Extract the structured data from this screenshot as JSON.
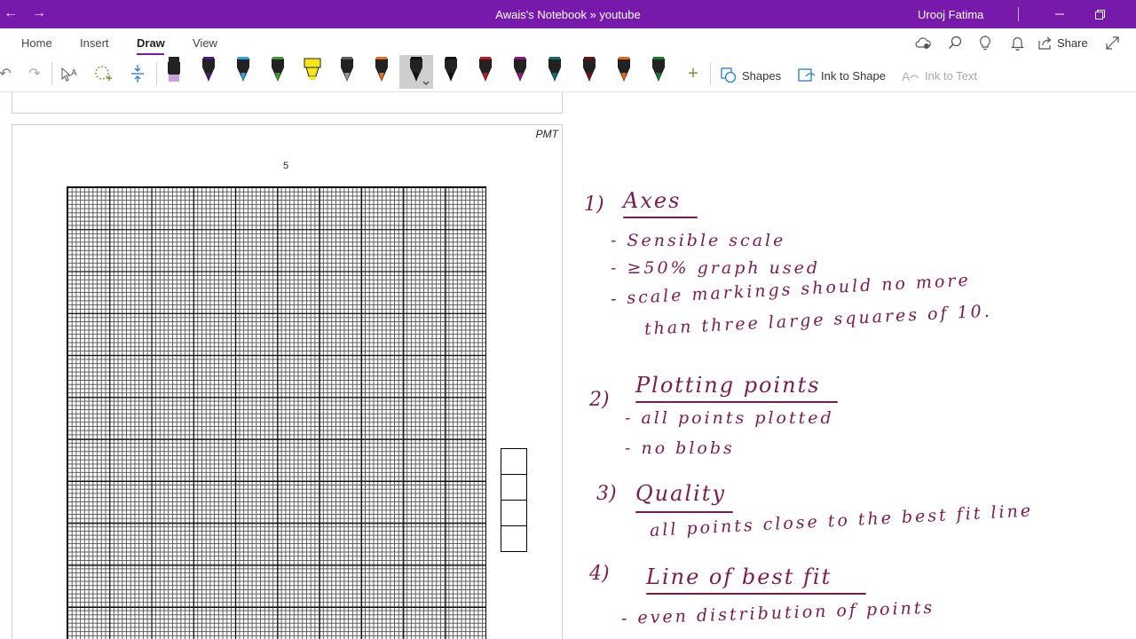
{
  "window": {
    "title": "Awais's Notebook » youtube",
    "user": "Urooj Fatima"
  },
  "tabs": [
    {
      "label": "Home"
    },
    {
      "label": "Insert"
    },
    {
      "label": "Draw",
      "active": true
    },
    {
      "label": "View"
    }
  ],
  "ribbon_right": {
    "share_label": "Share"
  },
  "toolbar": {
    "pens": [
      {
        "color": "#c9a0dc",
        "type": "highlighter"
      },
      {
        "color": "#4b1c7a",
        "type": "pen"
      },
      {
        "color": "#2aa7d8",
        "type": "pen"
      },
      {
        "color": "#3c9a2e",
        "type": "pen"
      },
      {
        "color": "#f5e61a",
        "type": "highlighter"
      },
      {
        "color": "#5b5b5b",
        "type": "pencil"
      },
      {
        "color": "#e07020",
        "type": "pen"
      },
      {
        "color": "#111111",
        "type": "pen",
        "selected": true
      },
      {
        "color": "#111111",
        "type": "pen"
      },
      {
        "color": "#c4161c",
        "type": "pen"
      },
      {
        "color": "#8e1a8a",
        "type": "pen"
      },
      {
        "color": "#0f6e6e",
        "type": "pen"
      },
      {
        "color": "#6a1515",
        "type": "pen"
      },
      {
        "color": "#e86a12",
        "type": "pen"
      },
      {
        "color": "#177a2a",
        "type": "pen"
      }
    ],
    "shapes_label": "Shapes",
    "ink_to_shape_label": "Ink to Shape",
    "ink_to_text_label": "Ink to Text"
  },
  "page": {
    "header": "PMT",
    "page_number": "5"
  },
  "notes": {
    "s1_num": "1)",
    "s1_title": "Axes",
    "s1_b1": "- Sensible scale",
    "s1_b2": "- ≥50% graph used",
    "s1_b3a": "- scale markings should no more",
    "s1_b3b": "than three large squares of 10.",
    "s2_num": "2)",
    "s2_title": "Plotting points",
    "s2_b1": "- all points plotted",
    "s2_b2": "- no blobs",
    "s3_num": "3)",
    "s3_title": "Quality",
    "s3_b1": "all points close to the best fit line",
    "s4_num": "4)",
    "s4_title": "Line of best fit",
    "s4_b1": "- even distribution of points"
  }
}
